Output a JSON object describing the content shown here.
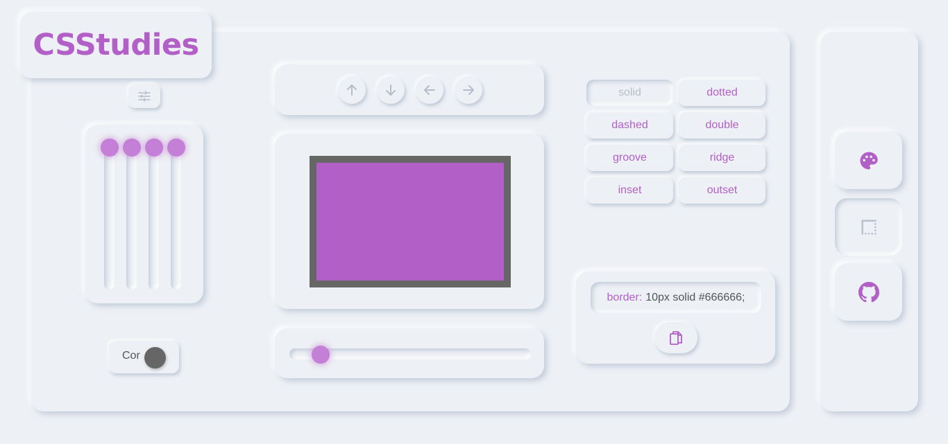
{
  "app": {
    "logo": "CSStudies"
  },
  "colors": {
    "accent": "#b25fc7",
    "thumb": "#c47fd6",
    "background": "#edf0f4",
    "border_color": "#666666",
    "muted": "#b8bcc8"
  },
  "toolbar": {
    "settings_icon": "sliders-icon"
  },
  "radius_sliders": {
    "levels": [
      0,
      0,
      0,
      0
    ]
  },
  "color_toggle": {
    "label": "Cor",
    "value": "#666666"
  },
  "direction_buttons": [
    {
      "icon": "arrow-up-icon"
    },
    {
      "icon": "arrow-down-icon"
    },
    {
      "icon": "arrow-left-icon"
    },
    {
      "icon": "arrow-right-icon"
    }
  ],
  "border_width_slider": {
    "level": 0.1
  },
  "border_styles": {
    "solid": "solid",
    "dotted": "dotted",
    "dashed": "dashed",
    "double": "double",
    "groove": "groove",
    "ridge": "ridge",
    "inset": "inset",
    "outset": "outset",
    "selected": "solid"
  },
  "code": {
    "property": "border:",
    "value": "10px solid #666666;",
    "copy_icon": "copy-icon"
  },
  "sidebar": {
    "items": [
      {
        "icon": "palette-icon"
      },
      {
        "icon": "border-icon"
      },
      {
        "icon": "github-icon"
      }
    ]
  }
}
